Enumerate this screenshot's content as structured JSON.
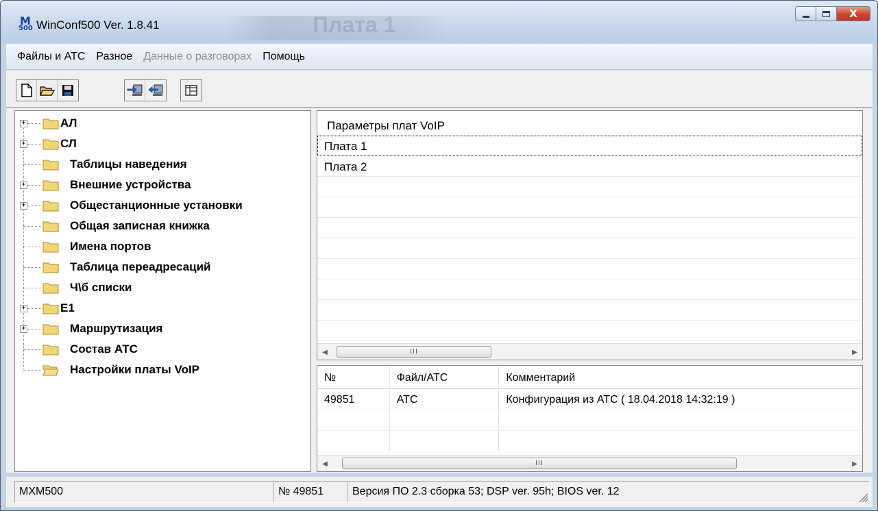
{
  "window": {
    "app_icon_top": "M",
    "app_icon_bottom": "500",
    "title": "WinConf500  Ver. 1.8.41",
    "ghost_title": "Плата 1",
    "close_label": "X"
  },
  "menu": [
    {
      "label": "Файлы и АТС",
      "enabled": true
    },
    {
      "label": "Разное",
      "enabled": true
    },
    {
      "label": "Данные о разговорах",
      "enabled": false
    },
    {
      "label": "Помощь",
      "enabled": true
    }
  ],
  "toolbar": {
    "buttons": [
      "new-file-icon",
      "open-folder-icon",
      "save-icon",
      "upload-to-pbx-icon",
      "download-from-pbx-icon",
      "split-view-icon"
    ]
  },
  "tree": {
    "items": [
      {
        "label": "АЛ",
        "expandable": true
      },
      {
        "label": "СЛ",
        "expandable": true
      },
      {
        "label": "Таблицы наведения",
        "expandable": false
      },
      {
        "label": "Внешние устройства",
        "expandable": true
      },
      {
        "label": "Общестанционные установки",
        "expandable": true
      },
      {
        "label": "Общая записная книжка",
        "expandable": false
      },
      {
        "label": "Имена портов",
        "expandable": false
      },
      {
        "label": "Таблица переадресаций",
        "expandable": false
      },
      {
        "label": "Ч\\б списки",
        "expandable": false
      },
      {
        "label": "E1",
        "expandable": true
      },
      {
        "label": "Маршрутизация",
        "expandable": true
      },
      {
        "label": "Состав АТС",
        "expandable": false
      },
      {
        "label": "Настройки платы VoIP",
        "expandable": false,
        "open": true
      }
    ]
  },
  "voip_panel": {
    "header": "Параметры плат VoIP",
    "rows": [
      "Плата 1",
      "Плата 2"
    ],
    "scroll_thumb": "III"
  },
  "config_list": {
    "columns": [
      "№",
      "Файл/АТС",
      "Комментарий"
    ],
    "rows": [
      {
        "num": "49851",
        "source": "АТС",
        "comment": "Конфигурация из АТС ( 18.04.2018 14:32:19 )"
      }
    ],
    "scroll_thumb": "III"
  },
  "status": {
    "model": "MXM500",
    "serial": "№ 49851",
    "version": "Версия ПО 2.3 сборка 53; DSP ver. 95h; BIOS ver. 12"
  }
}
